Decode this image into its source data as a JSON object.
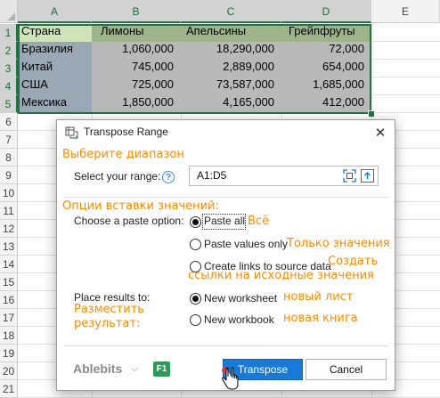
{
  "sheet": {
    "columns": [
      "A",
      "B",
      "C",
      "D",
      "E"
    ],
    "rows": [
      "1",
      "2",
      "3",
      "4",
      "5",
      "6",
      "7",
      "8",
      "9",
      "10",
      "11",
      "12",
      "13",
      "14",
      "15",
      "16",
      "17",
      "18",
      "19",
      "20",
      "21"
    ],
    "header": [
      "Страна",
      "Лимоны",
      "Апельсины",
      "Грейпфруты"
    ],
    "data": [
      [
        "Бразилия",
        "1,060,000",
        "18,290,000",
        "72,000"
      ],
      [
        "Китай",
        "745,000",
        "2,889,000",
        "654,000"
      ],
      [
        "США",
        "725,000",
        "73,587,000",
        "1,685,000"
      ],
      [
        "Мексика",
        "1,850,000",
        "4,165,000",
        "412,000"
      ]
    ]
  },
  "dialog": {
    "title": "Transpose Range",
    "close_glyph": "✕",
    "ru_select_range": "Выберите диапазон",
    "select_range_label": "Select your range:",
    "help_glyph": "?",
    "range_value": "A1:D5",
    "ru_paste_options": "Опции вставки значений:",
    "paste_option_label": "Choose a paste option:",
    "paste_all": "Paste all",
    "ru_paste_all": "Всё",
    "paste_values": "Paste values only",
    "ru_paste_values": "Только значения",
    "create_links": "Create links to source data",
    "ru_create_links_1": "Создать",
    "ru_create_links_2": "ссылки на исходные значения",
    "place_results_label": "Place results to:",
    "ru_place_results_1": "Разместить",
    "ru_place_results_2": "результат:",
    "new_worksheet": "New worksheet",
    "ru_new_worksheet": "новый лист",
    "new_workbook": "New workbook",
    "ru_new_workbook": "новая книга",
    "brand": "Ablebits",
    "brand_chevron": "⌵",
    "f1": "F1",
    "transpose_button": "Transpose",
    "cancel_button": "Cancel"
  },
  "colors": {
    "accent": "#217346",
    "annotation": "#ff8a00",
    "primary_button": "#1979d6"
  }
}
